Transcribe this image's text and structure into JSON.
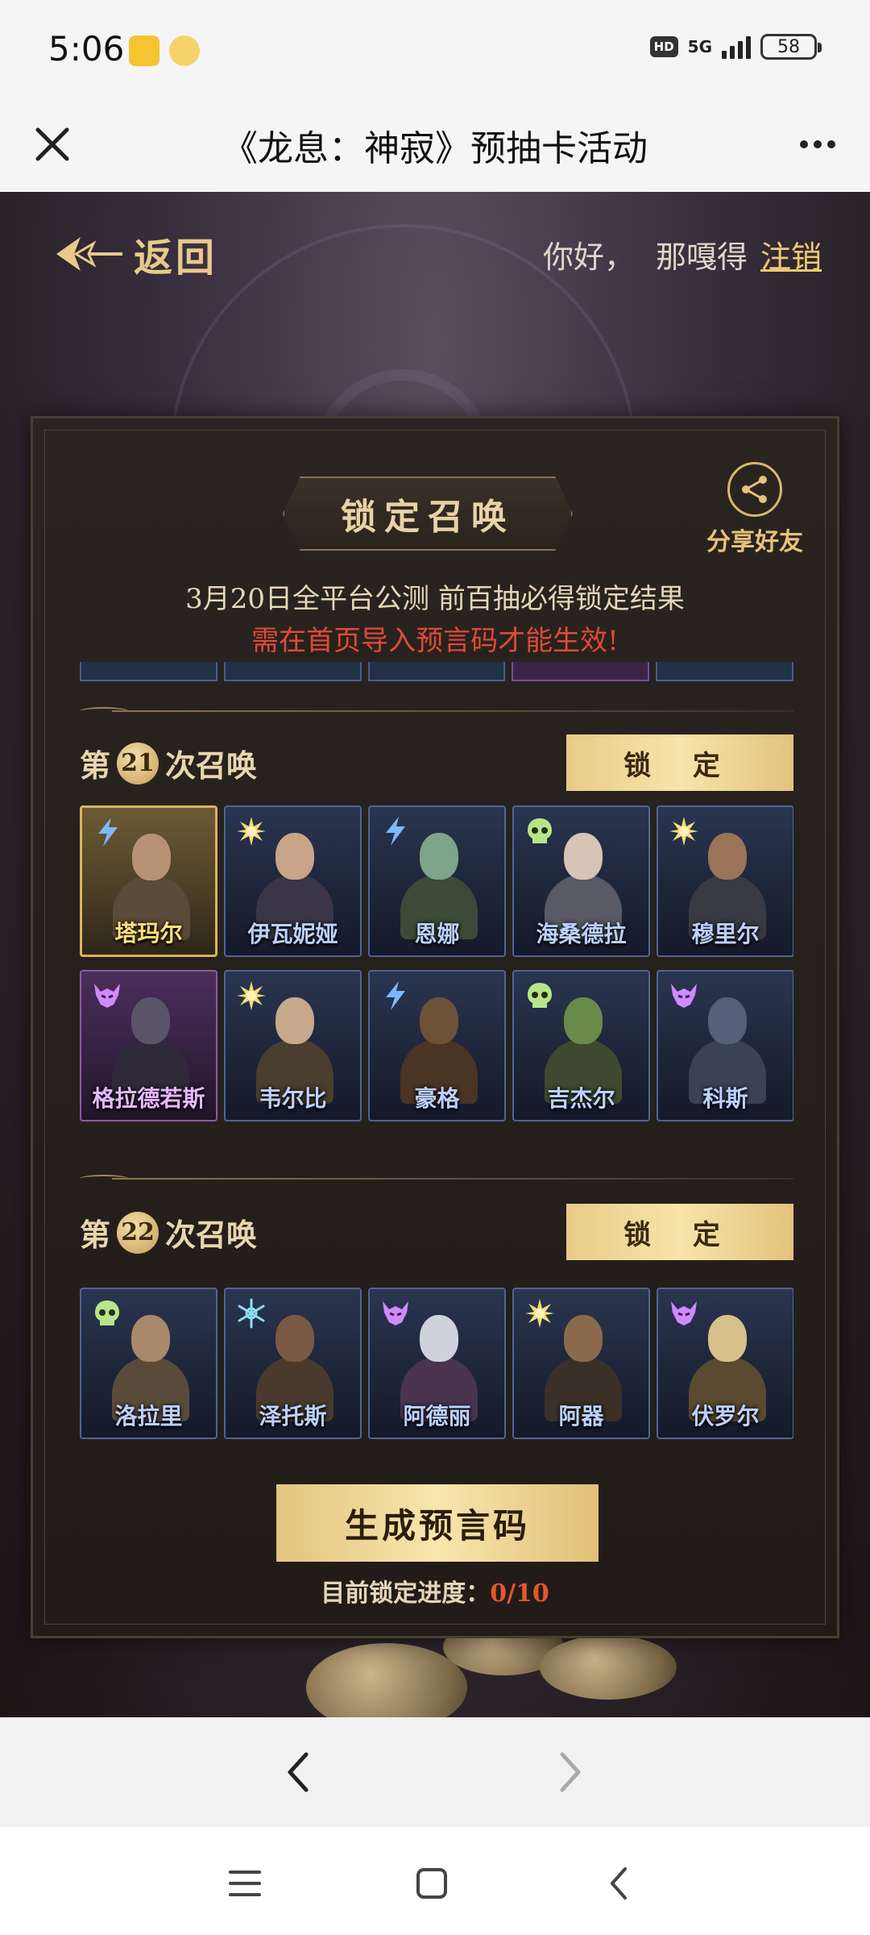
{
  "status_bar": {
    "time": "5:06",
    "network": "5G",
    "battery": "58",
    "hd": "HD"
  },
  "title_bar": {
    "title": "《龙息：神寂》预抽卡活动"
  },
  "header": {
    "back_label": "返回",
    "greeting": "你好，",
    "username": "那嘎得",
    "logout_label": "注销"
  },
  "panel": {
    "title": "锁定召唤",
    "share_label": "分享好友",
    "notice_line1": "3月20日全平台公测 前百抽必得锁定结果",
    "notice_line2": "需在首页导入预言码才能生效!"
  },
  "summons": [
    {
      "prefix": "第",
      "number": "21",
      "suffix": "次召唤",
      "lock_label": "锁 定",
      "heroes": [
        {
          "name": "塔玛尔",
          "icon": "lightning-icon",
          "frame": "gold"
        },
        {
          "name": "伊瓦妮娅",
          "icon": "sun-icon",
          "frame": "blue"
        },
        {
          "name": "恩娜",
          "icon": "lightning-icon",
          "frame": "blue"
        },
        {
          "name": "海桑德拉",
          "icon": "skull-icon",
          "frame": "blue"
        },
        {
          "name": "穆里尔",
          "icon": "sun-icon",
          "frame": "blue"
        },
        {
          "name": "格拉德若斯",
          "icon": "demon-icon",
          "frame": "purple"
        },
        {
          "name": "韦尔比",
          "icon": "sun-icon",
          "frame": "blue"
        },
        {
          "name": "豪格",
          "icon": "lightning-icon",
          "frame": "blue"
        },
        {
          "name": "吉杰尔",
          "icon": "skull-icon",
          "frame": "blue"
        },
        {
          "name": "科斯",
          "icon": "demon-icon",
          "frame": "blue"
        }
      ]
    },
    {
      "prefix": "第",
      "number": "22",
      "suffix": "次召唤",
      "lock_label": "锁 定",
      "heroes": [
        {
          "name": "洛拉里",
          "icon": "skull-icon",
          "frame": "blue"
        },
        {
          "name": "泽托斯",
          "icon": "snowflake-icon",
          "frame": "blue"
        },
        {
          "name": "阿德丽",
          "icon": "demon-icon",
          "frame": "blue"
        },
        {
          "name": "阿器",
          "icon": "sun-icon",
          "frame": "blue"
        },
        {
          "name": "伏罗尔",
          "icon": "demon-icon",
          "frame": "blue"
        }
      ]
    }
  ],
  "footer": {
    "generate_label": "生成预言码",
    "progress_label": "目前锁定进度：",
    "progress_value": "0/10"
  },
  "colors": {
    "accent_gold": "#e9cb86",
    "warning_red": "#e04a36",
    "progress_orange": "#e0582e"
  }
}
